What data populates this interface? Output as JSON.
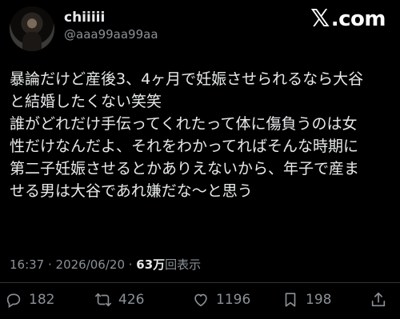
{
  "header": {
    "display_name": "chiiiii",
    "handle": "@aaa99aa99aa",
    "brand": ".com"
  },
  "tweet": {
    "text": "暴論だけど産後3、4ヶ月で妊娠させられるなら大谷\nと結婚したくない笑笑\n誰がどれだけ手伝ってくれたって体に傷負うのは女\n性だけなんだよ、それをわかってればそんな時期に\n第二子妊娠させるとかありえないから、年子で産ま\nせる男は大谷であれ嫌だな〜と思う"
  },
  "meta": {
    "time_date": "16:37 · 2026/06/20 · ",
    "views_count": "63万",
    "views_label": "回表示"
  },
  "actions": {
    "replies": "182",
    "reposts": "426",
    "likes": "1196",
    "bookmarks": "198"
  },
  "icons": [
    "reply-icon",
    "repost-icon",
    "like-icon",
    "bookmark-icon",
    "share-icon"
  ],
  "colors": {
    "background": "#000000",
    "text": "#e7e9ea",
    "secondary": "#8b9197"
  }
}
